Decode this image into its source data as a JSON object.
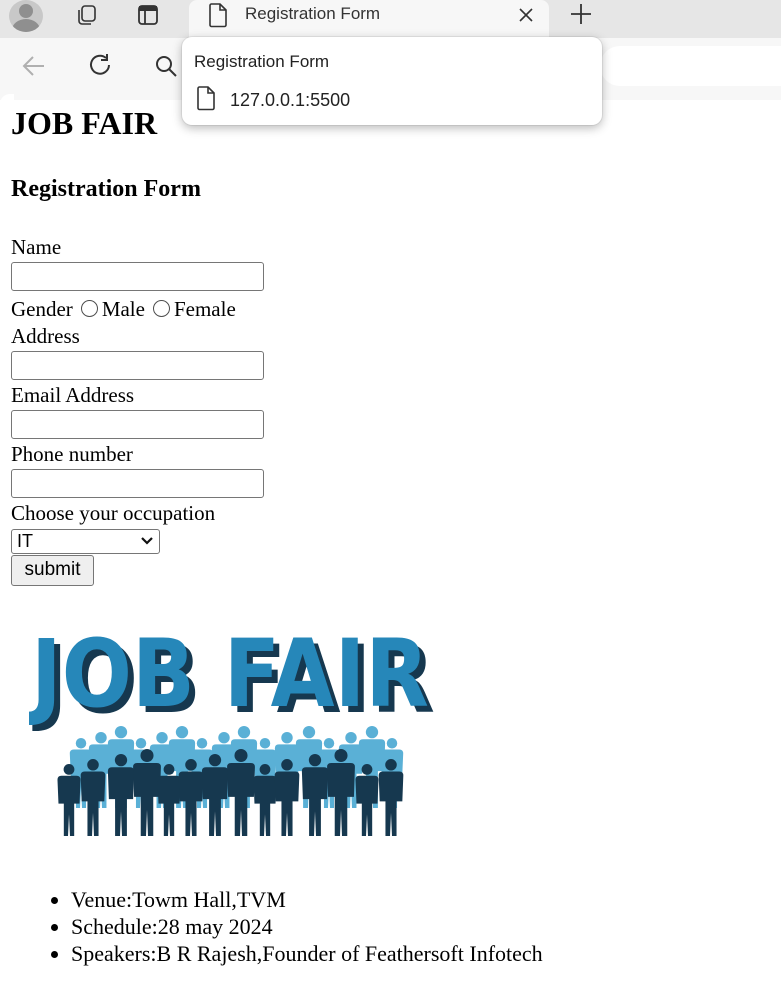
{
  "browser": {
    "tab_title": "Registration Form",
    "popup_title": "Registration Form",
    "popup_url": "127.0.0.1:5500"
  },
  "page": {
    "heading": "JOB FAIR",
    "subheading": "Registration Form",
    "form": {
      "name_label": "Name",
      "name_value": "",
      "gender_label": "Gender",
      "gender_options": [
        "Male",
        "Female"
      ],
      "address_label": "Address",
      "address_value": "",
      "email_label": "Email Address",
      "email_value": "",
      "phone_label": "Phone number",
      "phone_value": "",
      "occupation_label": "Choose your occupation",
      "occupation_selected": "IT",
      "submit_label": "submit"
    },
    "poster": {
      "text": "JOB FAIR",
      "colors": {
        "blue": "#2687b9",
        "light_blue": "#5ab0d6",
        "dark_navy": "#16384f"
      }
    },
    "details": [
      "Venue:Towm Hall,TVM",
      "Schedule:28 may 2024",
      "Speakers:B R Rajesh,Founder of Feathersoft Infotech"
    ]
  }
}
